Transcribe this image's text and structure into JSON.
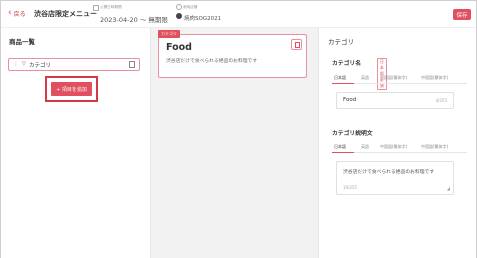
{
  "header": {
    "back_label": "戻る",
    "page_title": "渋谷店限定メニュー",
    "period_caption": "公開日時期間",
    "period_value": "2023-04-20 〜 無期限",
    "store_caption": "適用店舗",
    "store_value": "焼肉SOG2021",
    "save_label": "保存"
  },
  "left": {
    "heading": "商品一覧",
    "category_item_label": "カテゴリ",
    "add_item_label": "+ 項目を追加"
  },
  "middle": {
    "tag": "カテゴリ",
    "food_title": "Food",
    "food_description": "渋谷店だけで食べられる絶品のお料理です"
  },
  "right": {
    "heading": "カテゴリ",
    "name_section": {
      "title": "カテゴリ名",
      "required_badge": "日本語必須",
      "tabs": [
        "日本語",
        "英語",
        "中国語(簡体字)",
        "中国語(繁体字)"
      ],
      "value": "Food",
      "counter": "4/255"
    },
    "desc_section": {
      "title": "カテゴリ説明文",
      "tabs": [
        "日本語",
        "英語",
        "中国語(簡体字)",
        "中国語(繁体字)"
      ],
      "value": "渋谷店だけで食べられる絶品のお料理です",
      "counter": "19/255"
    }
  },
  "colors": {
    "accent": "#e0505e",
    "highlight_border": "#d23a4a"
  }
}
